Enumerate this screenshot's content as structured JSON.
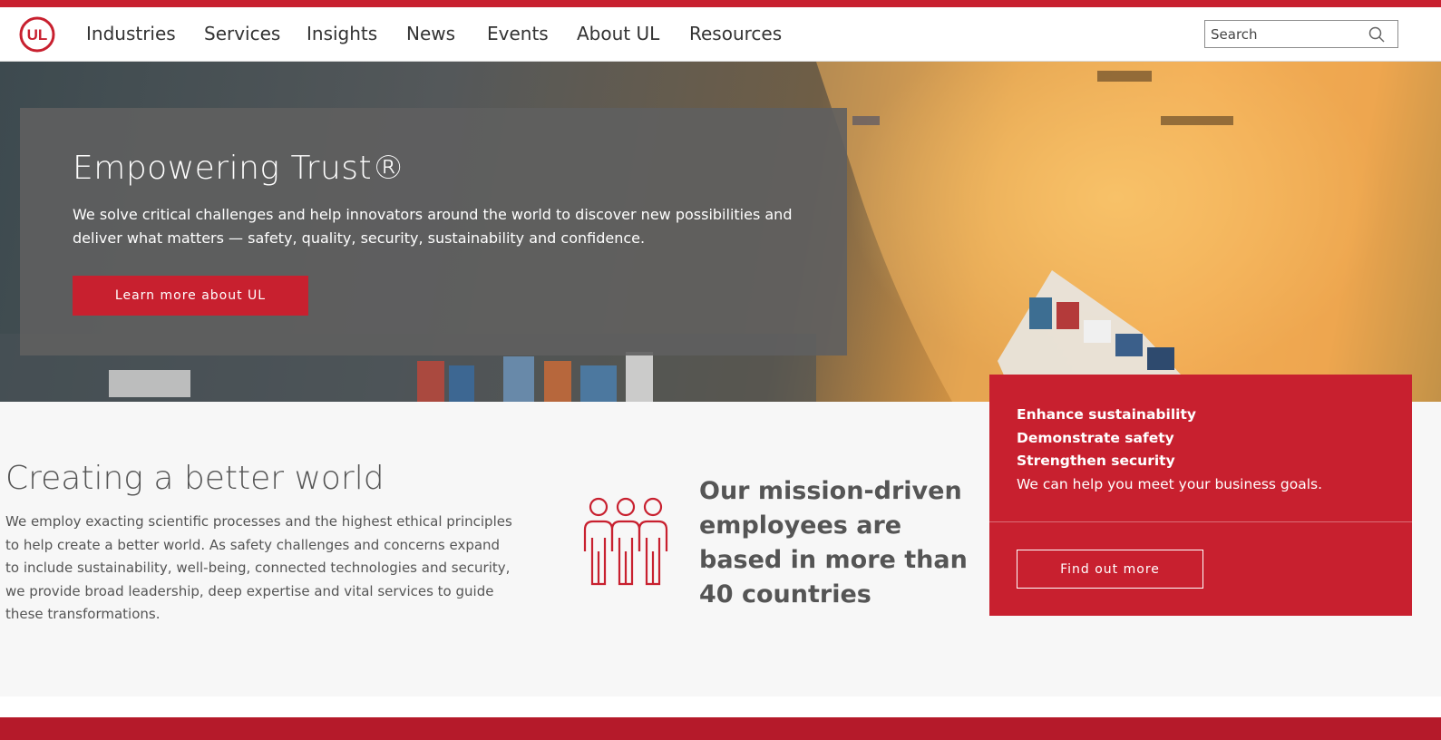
{
  "brand": {
    "logo_text": "UL",
    "accent_color": "#c8202f"
  },
  "nav": {
    "items": [
      "Industries",
      "Services",
      "Insights",
      "News",
      "Events",
      "About UL",
      "Resources"
    ]
  },
  "search": {
    "placeholder": "Search",
    "icon": "search-icon"
  },
  "hero": {
    "title": "Empowering Trust®",
    "text": "We solve critical challenges and help innovators around the world to discover new possibilities and deliver what matters — safety, quality, security, sustainability and confidence.",
    "button_label": "Learn more about UL"
  },
  "about": {
    "title": "Creating a better world",
    "text": "We employ exacting scientific processes and the highest ethical principles to help create a better world. As safety challenges and concerns expand to include sustainability, well-being, connected technologies and security, we provide broad leadership, deep expertise and vital services to guide these transformations."
  },
  "mission": {
    "icon": "people-icon",
    "text": "Our mission-driven employees are based in more than 40 countries"
  },
  "cta": {
    "line1": "Enhance sustainability",
    "line2": "Demonstrate safety",
    "line3": "Strengthen security",
    "line4": "We can help you meet your business goals.",
    "button_label": "Find out more"
  }
}
